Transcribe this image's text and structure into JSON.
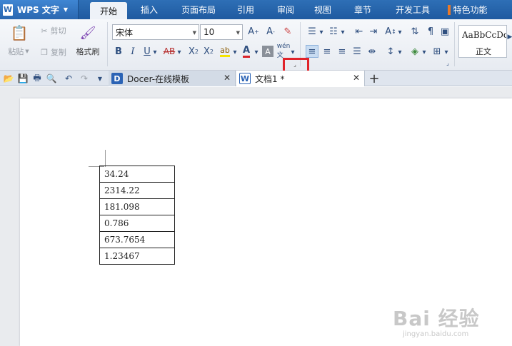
{
  "menubar": {
    "app_label": "WPS 文字",
    "app_logo": "W",
    "tabs": [
      {
        "label": "开始",
        "active": true
      },
      {
        "label": "插入"
      },
      {
        "label": "页面布局"
      },
      {
        "label": "引用"
      },
      {
        "label": "审阅"
      },
      {
        "label": "视图"
      },
      {
        "label": "章节"
      },
      {
        "label": "开发工具"
      },
      {
        "label": "特色功能"
      }
    ]
  },
  "ribbon": {
    "clipboard": {
      "paste_label": "粘贴",
      "cut_label": "剪切",
      "copy_label": "复制",
      "format_painter_label": "格式刷"
    },
    "font": {
      "font_name": "宋体",
      "font_size": "10"
    },
    "styles": {
      "preview_text": "AaBbCcDd",
      "style_name": "正文"
    },
    "colors": {
      "highlight": "#f5e400",
      "font_color": "#d8232a",
      "callout": "#e0232a"
    }
  },
  "tabbar": {
    "tabs": [
      {
        "label": "Docer-在线模板",
        "icon": "D"
      },
      {
        "label": "文档1 *",
        "icon": "W"
      }
    ]
  },
  "document": {
    "table_rows": [
      "34.24",
      "2314.22",
      "181.098",
      "0.786",
      "673.7654",
      "1.23467"
    ]
  },
  "watermark": {
    "logo": "Bai 经验",
    "url": "jingyan.baidu.com"
  }
}
